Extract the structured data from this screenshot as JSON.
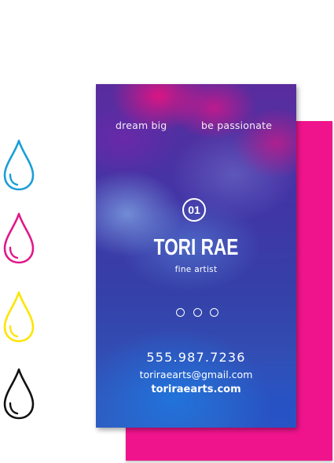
{
  "drops": [
    {
      "icon": "cyan-ink-drop-icon",
      "color": "#1a9ed8"
    },
    {
      "icon": "magenta-ink-drop-icon",
      "color": "#e0188a"
    },
    {
      "icon": "yellow-ink-drop-icon",
      "color": "#fde500"
    },
    {
      "icon": "black-ink-drop-icon",
      "color": "#111111"
    }
  ],
  "card": {
    "tagline_left": "dream big",
    "tagline_right": "be passionate",
    "badge_number": "01",
    "name": "TORI RAE",
    "title": "fine artist",
    "phone": "555.987.7236",
    "email": "toriraearts@gmail.com",
    "website": "toriraearts.com",
    "back_card_color": "#f0148c"
  }
}
